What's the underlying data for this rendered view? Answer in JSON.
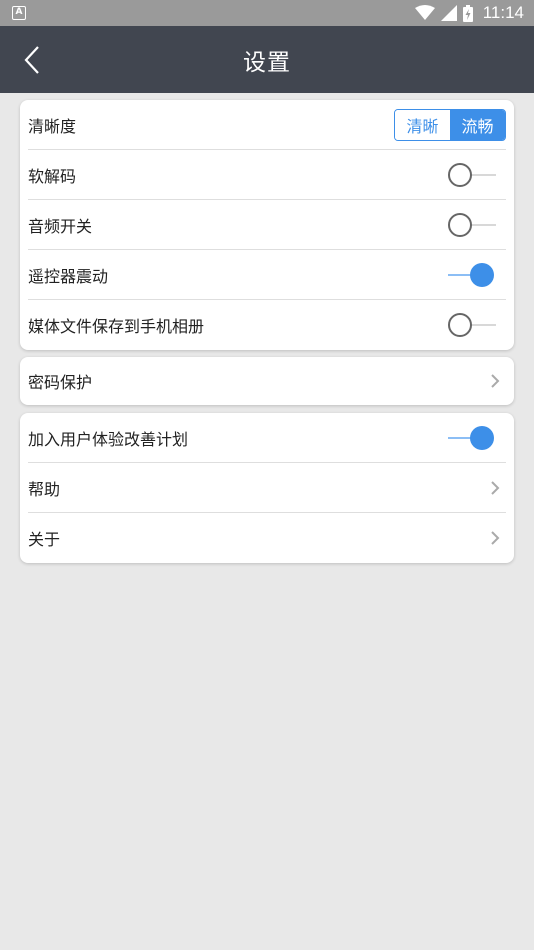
{
  "status_bar": {
    "time": "11:14",
    "notif_letter": "A"
  },
  "app_bar": {
    "title": "设置"
  },
  "settings": {
    "clarity": {
      "label": "清晰度",
      "options": [
        "清晰",
        "流畅"
      ],
      "selected": "流畅"
    },
    "soft_decode": {
      "label": "软解码",
      "on": false
    },
    "audio": {
      "label": "音频开关",
      "on": false
    },
    "remote_vibrate": {
      "label": "遥控器震动",
      "on": true
    },
    "save_media": {
      "label": "媒体文件保存到手机相册",
      "on": false
    },
    "password": {
      "label": "密码保护"
    },
    "ux_plan": {
      "label": "加入用户体验改善计划",
      "on": true
    },
    "help": {
      "label": "帮助"
    },
    "about": {
      "label": "关于"
    }
  },
  "colors": {
    "accent": "#3d8fe8",
    "app_bar": "#414650",
    "status_bar": "#9a9a9a",
    "background": "#e8e8e8"
  }
}
